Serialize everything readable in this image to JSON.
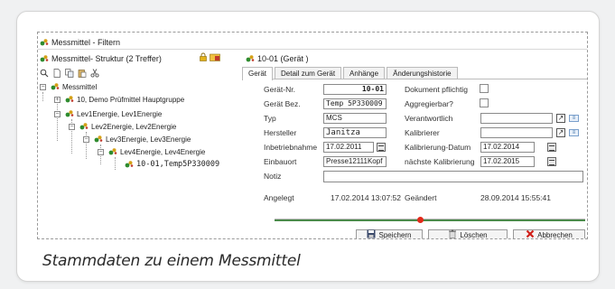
{
  "window": {
    "title": "Messmittel - Filtern"
  },
  "structure": {
    "label": "Messmittel- Struktur (2 Treffer)"
  },
  "detail": {
    "title": "10-01 (Gerät )"
  },
  "tree": {
    "nodes": [
      {
        "label": "Messmittel",
        "toggle": "−"
      },
      {
        "label": "10, Demo Prüfmittel Hauptgruppe",
        "toggle": "+"
      },
      {
        "label": "Lev1Energie, Lev1Energie",
        "toggle": "−"
      },
      {
        "label": "Lev2Energie, Lev2Energie",
        "toggle": "−"
      },
      {
        "label": "Lev3Energie, Lev3Energie",
        "toggle": "−"
      },
      {
        "label": "Lev4Energie, Lev4Energie",
        "toggle": "−"
      },
      {
        "label": "10-01,Temp5P330009",
        "toggle": ""
      }
    ]
  },
  "tabs": [
    {
      "label": "Gerät"
    },
    {
      "label": "Detail zum Gerät"
    },
    {
      "label": "Anhänge"
    },
    {
      "label": "Änderungshistorie"
    }
  ],
  "form": {
    "geraet_nr": {
      "label": "Gerät-Nr.",
      "value": "10-01"
    },
    "geraet_bez": {
      "label": "Gerät Bez.",
      "value": "Temp 5P330009"
    },
    "typ": {
      "label": "Typ",
      "value": "MCS"
    },
    "hersteller": {
      "label": "Hersteller",
      "value": "Janitza"
    },
    "inbetriebnahme": {
      "label": "Inbetriebnahme",
      "value": "17.02.2011"
    },
    "einbauort": {
      "label": "Einbauort",
      "value": "Presse12111Kopf"
    },
    "dokument": {
      "label": "Dokument pflichtig"
    },
    "aggregierbar": {
      "label": "Aggregierbar?"
    },
    "verantwortlich": {
      "label": "Verantwortlich",
      "value": ""
    },
    "kalibrierer": {
      "label": "Kalibrierer",
      "value": ""
    },
    "kal_datum": {
      "label": "Kalibrierung-Datum",
      "value": "17.02.2014"
    },
    "naechste_kal": {
      "label": "nächste Kalibrierung",
      "value": "17.02.2015"
    },
    "notiz": {
      "label": "Notiz",
      "value": ""
    },
    "angelegt": {
      "label": "Angelegt",
      "value": "17.02.2014 13:07:52"
    },
    "geaendert": {
      "label": "Geändert",
      "value": "28.09.2014 15:55:41"
    }
  },
  "buttons": {
    "save": "Speichern",
    "delete": "Löschen",
    "cancel": "Abbrechen"
  },
  "caption": "Stammdaten zu einem Messmittel"
}
